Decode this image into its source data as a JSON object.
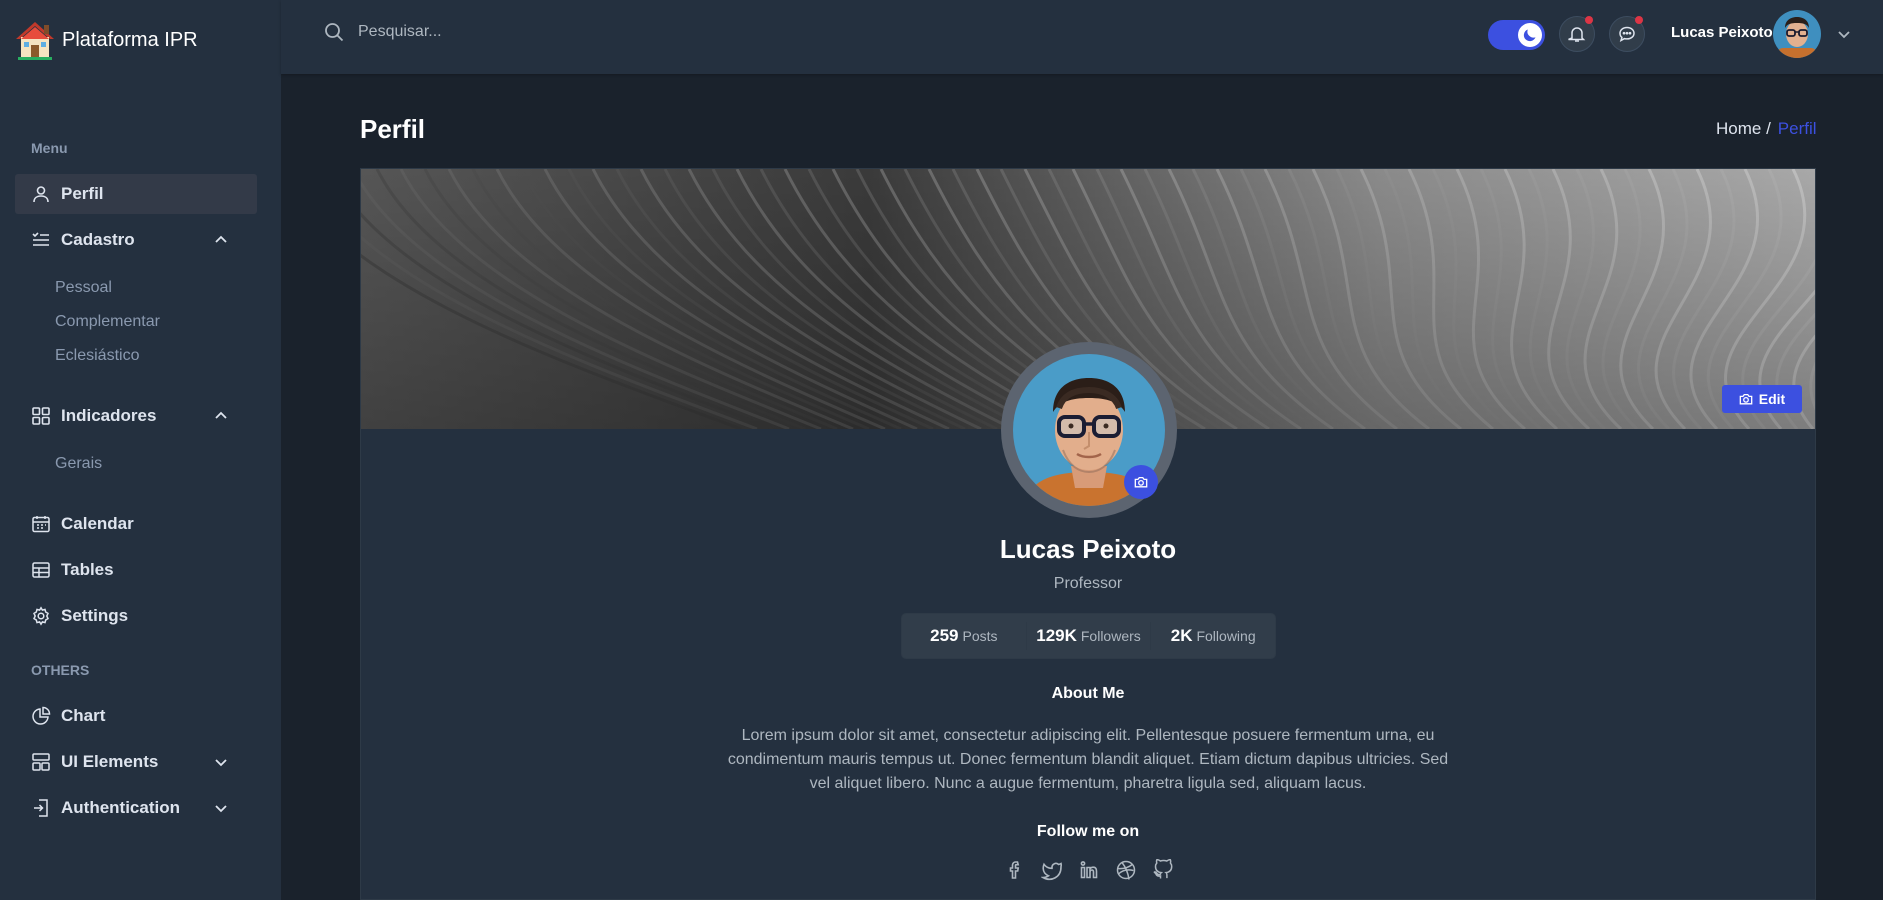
{
  "app": {
    "title": "Plataforma IPR"
  },
  "sidebar": {
    "group_menu": "Menu",
    "group_others": "OTHERS",
    "items": {
      "perfil": "Perfil",
      "cadastro": "Cadastro",
      "indicadores": "Indicadores",
      "calendar": "Calendar",
      "tables": "Tables",
      "settings": "Settings",
      "chart": "Chart",
      "ui_elements": "UI Elements",
      "authentication": "Authentication"
    },
    "cadastro_sub": [
      "Pessoal",
      "Complementar",
      "Eclesiástico"
    ],
    "indicadores_sub": [
      "Gerais"
    ]
  },
  "header": {
    "search_placeholder": "Pesquisar...",
    "user_name": "Lucas Peixoto",
    "dark_mode": "on"
  },
  "page": {
    "title": "Perfil",
    "breadcrumb_home": "Home /",
    "breadcrumb_current": "Perfil"
  },
  "profile": {
    "edit_label": "Edit",
    "name": "Lucas Peixoto",
    "role": "Professor",
    "stats": {
      "posts_value": "259",
      "posts_label": "Posts",
      "followers_value": "129K",
      "followers_label": "Followers",
      "following_value": "2K",
      "following_label": "Following"
    },
    "about_title": "About Me",
    "about_text": "Lorem ipsum dolor sit amet, consectetur adipiscing elit. Pellentesque posuere fermentum urna, eu condimentum mauris tempus ut. Donec fermentum blandit aliquet. Etiam dictum dapibus ultricies. Sed vel aliquet libero. Nunc a augue fermentum, pharetra ligula sed, aliquam lacus.",
    "follow_title": "Follow me on",
    "socials": [
      "facebook-icon",
      "twitter-icon",
      "linkedin-icon",
      "dribbble-icon",
      "github-icon"
    ]
  },
  "colors": {
    "accent": "#3c50e0",
    "sidebar": "#24303f",
    "body": "#1a222c",
    "notification_dot": "#dc3545"
  }
}
